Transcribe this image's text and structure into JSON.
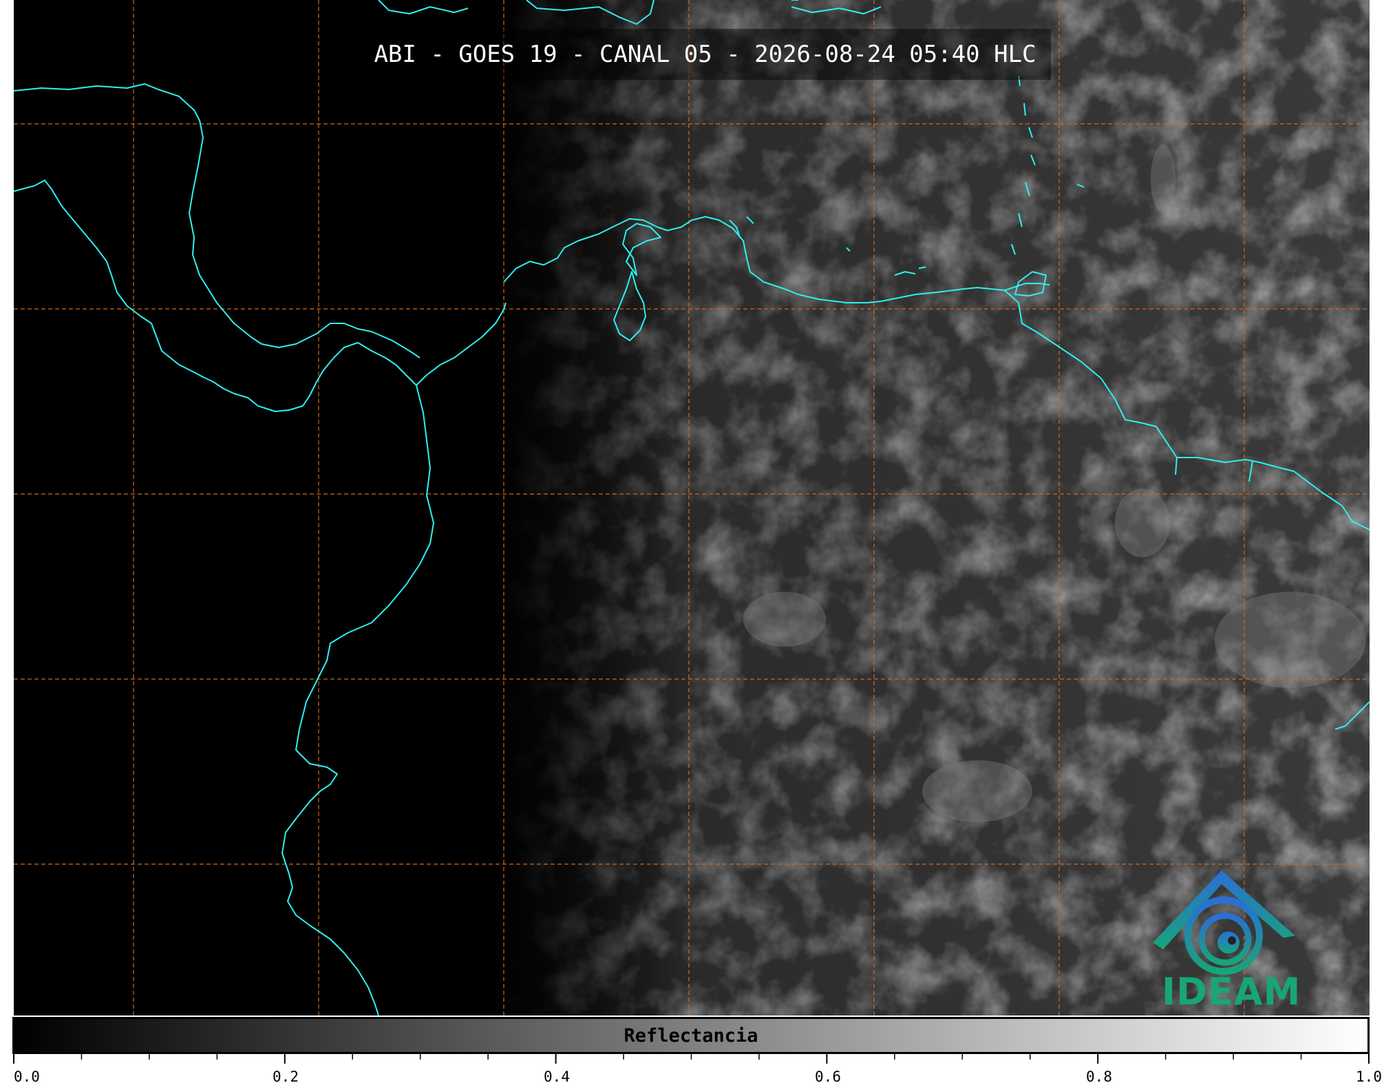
{
  "title": "ABI - GOES 19 - CANAL 05 - 2026-08-24 05:40 HLC",
  "logo": {
    "text": "IDEAM"
  },
  "colorbar": {
    "label": "Reflectancia",
    "range": [
      0.0,
      1.0
    ],
    "major_ticks": [
      "0.0",
      "0.2",
      "0.4",
      "0.6",
      "0.8",
      "1.0"
    ],
    "colormap": "grayscale"
  },
  "colors": {
    "coastline": "#2ef0f0",
    "gridlines": "#d2691e",
    "background": "#000000",
    "logo_blue": "#2a6fd6",
    "logo_green": "#18a578"
  }
}
